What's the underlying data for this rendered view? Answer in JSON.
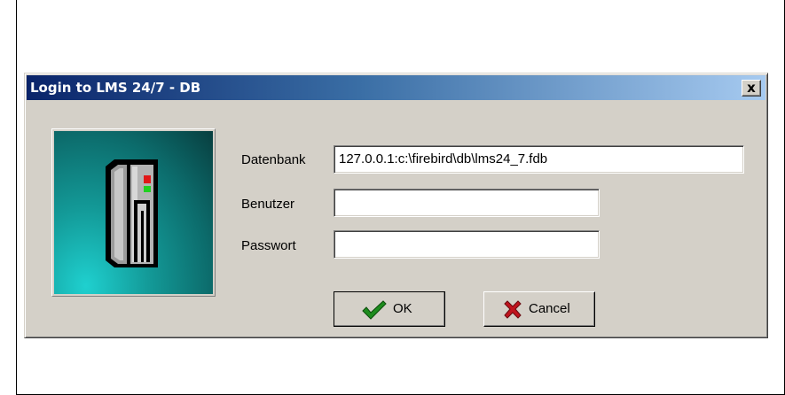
{
  "dialog": {
    "title": "Login to LMS 24/7 - DB",
    "close_label": "x",
    "fields": {
      "database_label": "Datenbank",
      "database_value": "127.0.0.1:c:\\firebird\\db\\lms24_7.fdb",
      "user_label": "Benutzer",
      "user_value": "",
      "password_label": "Passwort",
      "password_value": ""
    },
    "buttons": {
      "ok_label": "OK",
      "cancel_label": "Cancel"
    }
  },
  "colors": {
    "titlebar_start": "#0a246a",
    "titlebar_end": "#a6caf0",
    "dialog_face": "#d4d0c8",
    "ok_check": "#1e8c1e",
    "cancel_x": "#c0141e"
  },
  "icons": [
    "server-icon",
    "checkmark-icon",
    "cross-icon",
    "close-icon"
  ]
}
